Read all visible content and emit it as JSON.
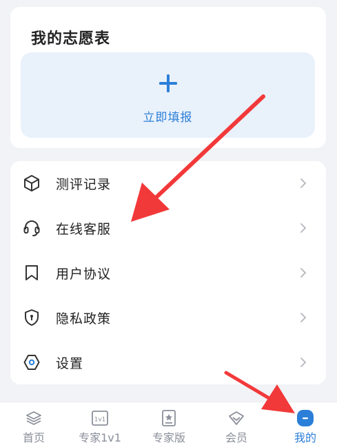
{
  "wishlist": {
    "title": "我的志愿表",
    "action_label": "立即填报"
  },
  "menu": {
    "items": [
      {
        "label": "测评记录",
        "icon": "cube-icon"
      },
      {
        "label": "在线客服",
        "icon": "headset-icon"
      },
      {
        "label": "用户协议",
        "icon": "bookmark-icon"
      },
      {
        "label": "隐私政策",
        "icon": "shield-icon"
      },
      {
        "label": "设置",
        "icon": "settings-icon"
      }
    ]
  },
  "tabbar": {
    "items": [
      {
        "label": "首页",
        "icon": "layers-icon",
        "active": false
      },
      {
        "label": "专家1v1",
        "icon": "1v1-icon",
        "active": false
      },
      {
        "label": "专家版",
        "icon": "star-doc-icon",
        "active": false
      },
      {
        "label": "会员",
        "icon": "gem-icon",
        "active": false
      },
      {
        "label": "我的",
        "icon": "profile-icon",
        "active": true
      }
    ],
    "badge_1v1": "1v1"
  },
  "colors": {
    "accent": "#2b7fd8",
    "annotation_arrow": "#f2393a",
    "background": "#f2f3f6",
    "fill_box": "#e9f1fb"
  }
}
